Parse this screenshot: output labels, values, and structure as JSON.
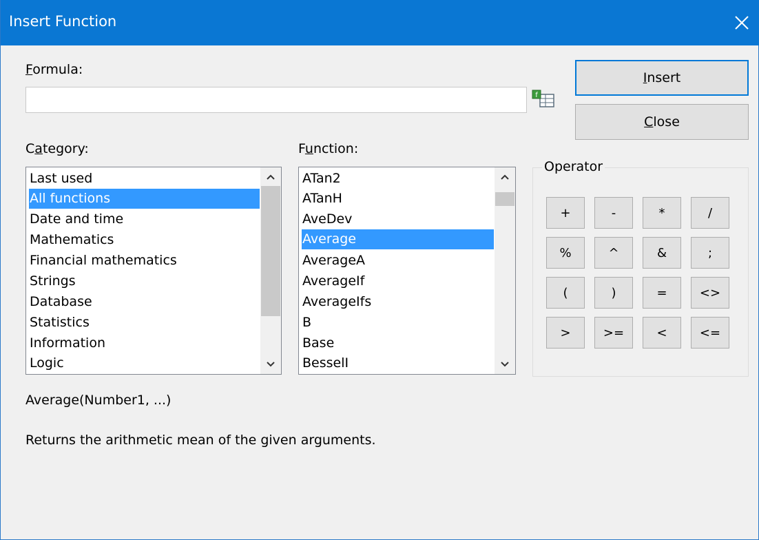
{
  "window": {
    "title": "Insert Function"
  },
  "formula": {
    "label_prefix": "",
    "label_accel": "F",
    "label_rest": "ormula:",
    "value": ""
  },
  "buttons": {
    "insert_accel": "I",
    "insert_rest": "nsert",
    "close_accel": "C",
    "close_rest": "lose"
  },
  "category": {
    "label_prefix": "C",
    "label_accel": "a",
    "label_rest": "tegory:",
    "items": [
      "Last used",
      "All functions",
      "Date and time",
      "Mathematics",
      "Financial mathematics",
      "Strings",
      "Database",
      "Statistics",
      "Information",
      "Logic"
    ],
    "selected": "All functions"
  },
  "function": {
    "label_prefix": "F",
    "label_accel": "u",
    "label_rest": "nction:",
    "items": [
      "ATan2",
      "ATanH",
      "AveDev",
      "Average",
      "AverageA",
      "AverageIf",
      "AverageIfs",
      "B",
      "Base",
      "BesselI"
    ],
    "selected": "Average"
  },
  "operator": {
    "label": "Operator",
    "rows": [
      [
        "+",
        "-",
        "*",
        "/"
      ],
      [
        "%",
        "^",
        "&",
        ";"
      ],
      [
        "(",
        ")",
        "=",
        "<>"
      ],
      [
        ">",
        ">=",
        "<",
        "<="
      ]
    ]
  },
  "syntax": "Average(Number1, ...)",
  "description": "Returns the arithmetic mean of the given arguments.",
  "icons": {
    "close": "close-icon",
    "formula_picker": "spreadsheet-function-icon",
    "scroll_up": "chevron-up-icon",
    "scroll_down": "chevron-down-icon"
  }
}
